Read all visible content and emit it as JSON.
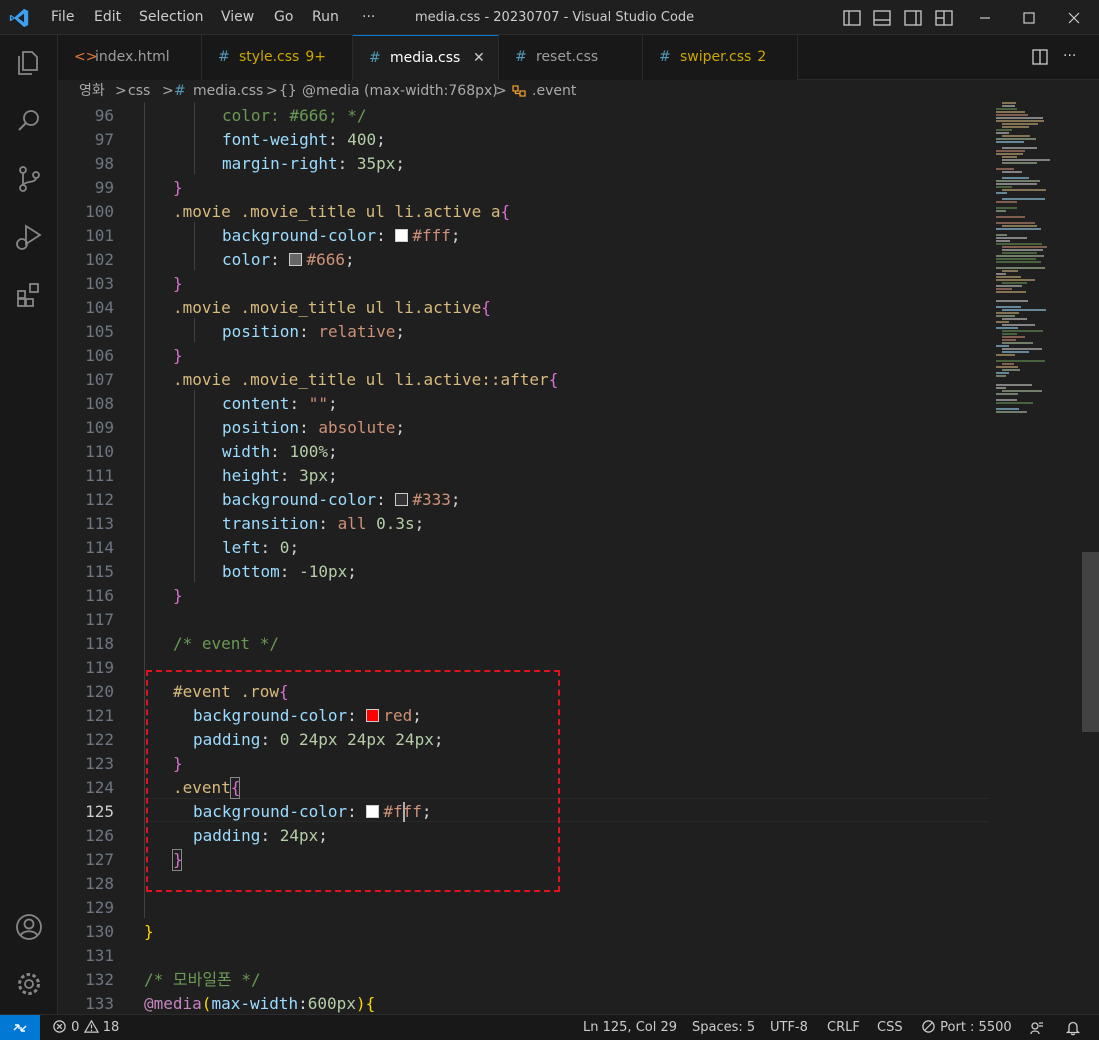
{
  "menu": [
    "File",
    "Edit",
    "Selection",
    "View",
    "Go",
    "Run",
    "···"
  ],
  "window_title": "media.css - 20230707 - Visual Studio Code",
  "tabs": [
    {
      "icon": "<>",
      "label": "index.html",
      "badge": ""
    },
    {
      "icon": "#",
      "label": "style.css",
      "badge": "9+"
    },
    {
      "icon": "#",
      "label": "media.css",
      "badge": ""
    },
    {
      "icon": "#",
      "label": "reset.css",
      "badge": ""
    },
    {
      "icon": "#",
      "label": "swiper.css",
      "badge": "2"
    }
  ],
  "tab_close": "✕",
  "breadcrumb": {
    "folder1": "영화",
    "folder2": "css",
    "file_icon": "#",
    "file": "media.css",
    "scope_icon": "{}",
    "scope": "@media (max-width:768px)",
    "symbol": ".event",
    "sep": ">"
  },
  "line_numbers": [
    "96",
    "97",
    "98",
    "99",
    "100",
    "101",
    "102",
    "103",
    "104",
    "105",
    "106",
    "107",
    "108",
    "109",
    "110",
    "111",
    "112",
    "113",
    "114",
    "115",
    "116",
    "117",
    "118",
    "119",
    "120",
    "121",
    "122",
    "123",
    "124",
    "125",
    "126",
    "127",
    "128",
    "129",
    "130",
    "131",
    "132",
    "133"
  ],
  "current_line": "125",
  "code": {
    "l96": [
      "color: #666; */"
    ],
    "l97": [
      "font-weight",
      ": ",
      "400",
      ";"
    ],
    "l98": [
      "margin-right",
      ": ",
      "35px",
      ";"
    ],
    "l99": [
      "}"
    ],
    "l100": [
      ".movie .movie_title ul li.active a",
      "{"
    ],
    "l101": [
      "background-color",
      ": ",
      "#fff",
      ";"
    ],
    "l102": [
      "color",
      ": ",
      "#666",
      ";"
    ],
    "l103": [
      "}"
    ],
    "l104": [
      ".movie .movie_title ul li.active",
      "{"
    ],
    "l105": [
      "position",
      ": ",
      "relative",
      ";"
    ],
    "l106": [
      "}"
    ],
    "l107": [
      ".movie .movie_title ul li.active::after",
      "{"
    ],
    "l108": [
      "content",
      ": ",
      "\"\"",
      ";"
    ],
    "l109": [
      "position",
      ": ",
      "absolute",
      ";"
    ],
    "l110": [
      "width",
      ": ",
      "100%",
      ";"
    ],
    "l111": [
      "height",
      ": ",
      "3px",
      ";"
    ],
    "l112": [
      "background-color",
      ": ",
      "#333",
      ";"
    ],
    "l113": [
      "transition",
      ": ",
      "all",
      " ",
      "0.3s",
      ";"
    ],
    "l114": [
      "left",
      ": ",
      "0",
      ";"
    ],
    "l115": [
      "bottom",
      ": ",
      "-10px",
      ";"
    ],
    "l116": [
      "}"
    ],
    "l118": [
      "/* event */"
    ],
    "l120": [
      "#event .row",
      "{"
    ],
    "l121": [
      "background-color",
      ": ",
      "red",
      ";"
    ],
    "l122": [
      "padding",
      ": ",
      "0 24px 24px 24px",
      ";"
    ],
    "l123": [
      "}"
    ],
    "l124": [
      ".event",
      "{"
    ],
    "l125": [
      "background-color",
      ": ",
      "#fff",
      ";"
    ],
    "l126": [
      "padding",
      ": ",
      "24px",
      ";"
    ],
    "l127": [
      "}"
    ],
    "l130": [
      "}"
    ],
    "l132": [
      "/* 모바일폰 */"
    ],
    "l133": [
      "@media",
      "(",
      "max-width",
      ":",
      "600px",
      ")",
      "{"
    ]
  },
  "swatch_colors": {
    "fff": "#ffffff",
    "666": "#666666",
    "333": "#333333",
    "red": "#ff0000"
  },
  "status": {
    "errors": "0",
    "warnings": "18",
    "position": "Ln 125, Col 29",
    "spaces": "Spaces: 5",
    "encoding": "UTF-8",
    "eol": "CRLF",
    "language": "CSS",
    "port": "Port : 5500"
  },
  "colors": {
    "accent": "#0078d4",
    "annotation": "#e0141e"
  }
}
